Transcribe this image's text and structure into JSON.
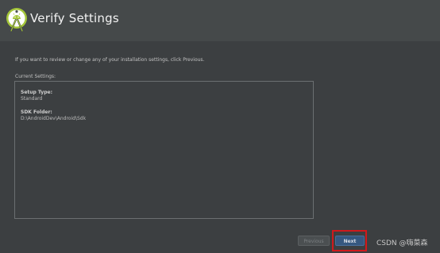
{
  "header": {
    "title": "Verify Settings",
    "logo_icon": "android-studio-icon",
    "accent_color": "#a4c639"
  },
  "main": {
    "intro_text": "If you want to review or change any of your installation settings, click Previous.",
    "section_label": "Current Settings:",
    "settings": [
      {
        "label": "Setup Type:",
        "value": "Standard"
      },
      {
        "label": "SDK Folder:",
        "value": "D:\\AndroidDev\\Android\\Sdk"
      }
    ]
  },
  "footer": {
    "previous_label": "Previous",
    "next_label": "Next",
    "highlight_color": "#d0191c"
  },
  "watermark": "CSDN @嗨菜森"
}
